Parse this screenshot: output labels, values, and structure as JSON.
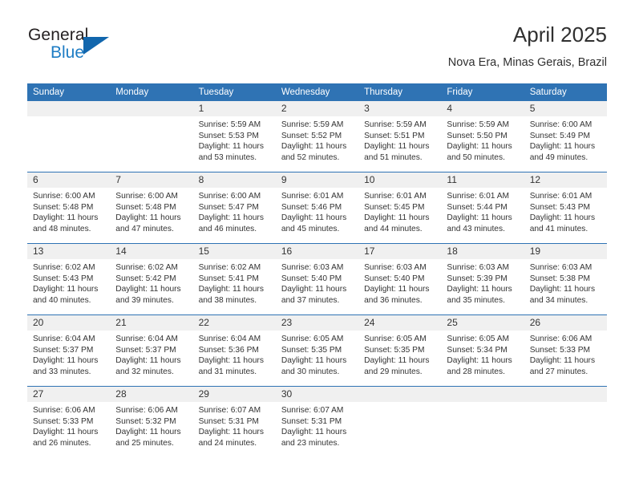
{
  "brand": {
    "name_part1": "General",
    "name_part2": "Blue",
    "triangle_icon": "triangle-logo-icon"
  },
  "header": {
    "title": "April 2025",
    "subtitle": "Nova Era, Minas Gerais, Brazil"
  },
  "colors": {
    "header_blue": "#2F73B4",
    "brand_blue": "#1D7CC4",
    "daynum_band": "#F0F0F0",
    "text": "#333333"
  },
  "calendar": {
    "weekday_headers": [
      "Sunday",
      "Monday",
      "Tuesday",
      "Wednesday",
      "Thursday",
      "Friday",
      "Saturday"
    ],
    "labels": {
      "sunrise": "Sunrise:",
      "sunset": "Sunset:",
      "daylight": "Daylight:"
    },
    "weeks": [
      [
        {
          "day": "",
          "sunrise": "",
          "sunset": "",
          "daylight_l1": "",
          "daylight_l2": ""
        },
        {
          "day": "",
          "sunrise": "",
          "sunset": "",
          "daylight_l1": "",
          "daylight_l2": ""
        },
        {
          "day": "1",
          "sunrise": "Sunrise: 5:59 AM",
          "sunset": "Sunset: 5:53 PM",
          "daylight_l1": "Daylight: 11 hours",
          "daylight_l2": "and 53 minutes."
        },
        {
          "day": "2",
          "sunrise": "Sunrise: 5:59 AM",
          "sunset": "Sunset: 5:52 PM",
          "daylight_l1": "Daylight: 11 hours",
          "daylight_l2": "and 52 minutes."
        },
        {
          "day": "3",
          "sunrise": "Sunrise: 5:59 AM",
          "sunset": "Sunset: 5:51 PM",
          "daylight_l1": "Daylight: 11 hours",
          "daylight_l2": "and 51 minutes."
        },
        {
          "day": "4",
          "sunrise": "Sunrise: 5:59 AM",
          "sunset": "Sunset: 5:50 PM",
          "daylight_l1": "Daylight: 11 hours",
          "daylight_l2": "and 50 minutes."
        },
        {
          "day": "5",
          "sunrise": "Sunrise: 6:00 AM",
          "sunset": "Sunset: 5:49 PM",
          "daylight_l1": "Daylight: 11 hours",
          "daylight_l2": "and 49 minutes."
        }
      ],
      [
        {
          "day": "6",
          "sunrise": "Sunrise: 6:00 AM",
          "sunset": "Sunset: 5:48 PM",
          "daylight_l1": "Daylight: 11 hours",
          "daylight_l2": "and 48 minutes."
        },
        {
          "day": "7",
          "sunrise": "Sunrise: 6:00 AM",
          "sunset": "Sunset: 5:48 PM",
          "daylight_l1": "Daylight: 11 hours",
          "daylight_l2": "and 47 minutes."
        },
        {
          "day": "8",
          "sunrise": "Sunrise: 6:00 AM",
          "sunset": "Sunset: 5:47 PM",
          "daylight_l1": "Daylight: 11 hours",
          "daylight_l2": "and 46 minutes."
        },
        {
          "day": "9",
          "sunrise": "Sunrise: 6:01 AM",
          "sunset": "Sunset: 5:46 PM",
          "daylight_l1": "Daylight: 11 hours",
          "daylight_l2": "and 45 minutes."
        },
        {
          "day": "10",
          "sunrise": "Sunrise: 6:01 AM",
          "sunset": "Sunset: 5:45 PM",
          "daylight_l1": "Daylight: 11 hours",
          "daylight_l2": "and 44 minutes."
        },
        {
          "day": "11",
          "sunrise": "Sunrise: 6:01 AM",
          "sunset": "Sunset: 5:44 PM",
          "daylight_l1": "Daylight: 11 hours",
          "daylight_l2": "and 43 minutes."
        },
        {
          "day": "12",
          "sunrise": "Sunrise: 6:01 AM",
          "sunset": "Sunset: 5:43 PM",
          "daylight_l1": "Daylight: 11 hours",
          "daylight_l2": "and 41 minutes."
        }
      ],
      [
        {
          "day": "13",
          "sunrise": "Sunrise: 6:02 AM",
          "sunset": "Sunset: 5:43 PM",
          "daylight_l1": "Daylight: 11 hours",
          "daylight_l2": "and 40 minutes."
        },
        {
          "day": "14",
          "sunrise": "Sunrise: 6:02 AM",
          "sunset": "Sunset: 5:42 PM",
          "daylight_l1": "Daylight: 11 hours",
          "daylight_l2": "and 39 minutes."
        },
        {
          "day": "15",
          "sunrise": "Sunrise: 6:02 AM",
          "sunset": "Sunset: 5:41 PM",
          "daylight_l1": "Daylight: 11 hours",
          "daylight_l2": "and 38 minutes."
        },
        {
          "day": "16",
          "sunrise": "Sunrise: 6:03 AM",
          "sunset": "Sunset: 5:40 PM",
          "daylight_l1": "Daylight: 11 hours",
          "daylight_l2": "and 37 minutes."
        },
        {
          "day": "17",
          "sunrise": "Sunrise: 6:03 AM",
          "sunset": "Sunset: 5:40 PM",
          "daylight_l1": "Daylight: 11 hours",
          "daylight_l2": "and 36 minutes."
        },
        {
          "day": "18",
          "sunrise": "Sunrise: 6:03 AM",
          "sunset": "Sunset: 5:39 PM",
          "daylight_l1": "Daylight: 11 hours",
          "daylight_l2": "and 35 minutes."
        },
        {
          "day": "19",
          "sunrise": "Sunrise: 6:03 AM",
          "sunset": "Sunset: 5:38 PM",
          "daylight_l1": "Daylight: 11 hours",
          "daylight_l2": "and 34 minutes."
        }
      ],
      [
        {
          "day": "20",
          "sunrise": "Sunrise: 6:04 AM",
          "sunset": "Sunset: 5:37 PM",
          "daylight_l1": "Daylight: 11 hours",
          "daylight_l2": "and 33 minutes."
        },
        {
          "day": "21",
          "sunrise": "Sunrise: 6:04 AM",
          "sunset": "Sunset: 5:37 PM",
          "daylight_l1": "Daylight: 11 hours",
          "daylight_l2": "and 32 minutes."
        },
        {
          "day": "22",
          "sunrise": "Sunrise: 6:04 AM",
          "sunset": "Sunset: 5:36 PM",
          "daylight_l1": "Daylight: 11 hours",
          "daylight_l2": "and 31 minutes."
        },
        {
          "day": "23",
          "sunrise": "Sunrise: 6:05 AM",
          "sunset": "Sunset: 5:35 PM",
          "daylight_l1": "Daylight: 11 hours",
          "daylight_l2": "and 30 minutes."
        },
        {
          "day": "24",
          "sunrise": "Sunrise: 6:05 AM",
          "sunset": "Sunset: 5:35 PM",
          "daylight_l1": "Daylight: 11 hours",
          "daylight_l2": "and 29 minutes."
        },
        {
          "day": "25",
          "sunrise": "Sunrise: 6:05 AM",
          "sunset": "Sunset: 5:34 PM",
          "daylight_l1": "Daylight: 11 hours",
          "daylight_l2": "and 28 minutes."
        },
        {
          "day": "26",
          "sunrise": "Sunrise: 6:06 AM",
          "sunset": "Sunset: 5:33 PM",
          "daylight_l1": "Daylight: 11 hours",
          "daylight_l2": "and 27 minutes."
        }
      ],
      [
        {
          "day": "27",
          "sunrise": "Sunrise: 6:06 AM",
          "sunset": "Sunset: 5:33 PM",
          "daylight_l1": "Daylight: 11 hours",
          "daylight_l2": "and 26 minutes."
        },
        {
          "day": "28",
          "sunrise": "Sunrise: 6:06 AM",
          "sunset": "Sunset: 5:32 PM",
          "daylight_l1": "Daylight: 11 hours",
          "daylight_l2": "and 25 minutes."
        },
        {
          "day": "29",
          "sunrise": "Sunrise: 6:07 AM",
          "sunset": "Sunset: 5:31 PM",
          "daylight_l1": "Daylight: 11 hours",
          "daylight_l2": "and 24 minutes."
        },
        {
          "day": "30",
          "sunrise": "Sunrise: 6:07 AM",
          "sunset": "Sunset: 5:31 PM",
          "daylight_l1": "Daylight: 11 hours",
          "daylight_l2": "and 23 minutes."
        },
        {
          "day": "",
          "sunrise": "",
          "sunset": "",
          "daylight_l1": "",
          "daylight_l2": ""
        },
        {
          "day": "",
          "sunrise": "",
          "sunset": "",
          "daylight_l1": "",
          "daylight_l2": ""
        },
        {
          "day": "",
          "sunrise": "",
          "sunset": "",
          "daylight_l1": "",
          "daylight_l2": ""
        }
      ]
    ]
  }
}
